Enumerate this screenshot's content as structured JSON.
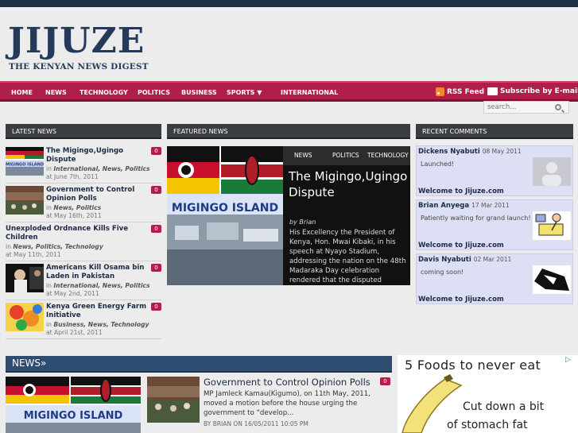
{
  "site": {
    "title": "JIJUZE",
    "tagline": "THE KENYAN NEWS DIGEST"
  },
  "nav": {
    "items": [
      "HOME",
      "NEWS",
      "TECHNOLOGY",
      "POLITICS",
      "BUSINESS",
      "SPORTS",
      "INTERNATIONAL"
    ],
    "rss": "RSS Feed",
    "subscribe": "Subscribe by E-mail"
  },
  "search": {
    "placeholder": "search..."
  },
  "latest": {
    "heading": "LATEST NEWS",
    "items": [
      {
        "title": "The Migingo,Ugingo Dispute",
        "prefix": "in",
        "categories": "International, News, Politics",
        "date": "at June 7th, 2011",
        "count": "0"
      },
      {
        "title": "Government to Control Opinion Polls",
        "prefix": "in",
        "categories": "News, Politics",
        "date": "at May 16th, 2011",
        "count": "0"
      },
      {
        "title": "Unexploded Ordnance Kills Five Children",
        "prefix": "in",
        "categories": "News, Politics, Technology",
        "date": "at May 11th, 2011",
        "count": "0"
      },
      {
        "title": "Americans Kill Osama bin Laden in Pakistan",
        "prefix": "in",
        "categories": "International, News, Politics",
        "date": "at May 2nd, 2011",
        "count": "0"
      },
      {
        "title": "Kenya Green Energy Farm Initiative",
        "prefix": "in",
        "categories": "Business, News, Technology",
        "date": "at April 21st, 2011",
        "count": "0"
      }
    ]
  },
  "featured": {
    "heading": "FEATURED NEWS",
    "tabs": [
      "NEWS",
      "POLITICS",
      "TECHNOLOGY"
    ],
    "title": "The Migingo,Ugingo Dispute",
    "by": "by Brian",
    "text": "His Excellency the President of Kenya, Hon. Mwai Kibaki, in his speech at Nyayo Stadium, addressing the nation on the 48th Madaraka Day celebration rendered that the disputed",
    "image_caption": "MIGINGO ISLAND"
  },
  "comments": {
    "heading": "RECENT COMMENTS",
    "items": [
      {
        "name": "Dickens Nyabuti",
        "date": "08 May 2011",
        "text": "Launched!",
        "post": "Welcome to Jijuze.com"
      },
      {
        "name": "Brian Anyega",
        "date": "17 Mar 2011",
        "text": "Patiently waiting for grand launch!",
        "post": "Welcome to Jijuze.com"
      },
      {
        "name": "Davis Nyabuti",
        "date": "02 Mar 2011",
        "text": "coming soon!",
        "post": "Welcome to Jijuze.com"
      }
    ]
  },
  "news_section": {
    "heading": "NEWS»",
    "big_caption": "MIGINGO ISLAND",
    "article": {
      "title": "Government to Control Opinion Polls",
      "count": "0",
      "excerpt": "MP Jamleck Kamau(Kigumo), on 11th May, 2011, moved a motion before the house urging the government to “develop...",
      "meta": "BY BRIAN ON 16/05/2011 10:05 PM"
    }
  },
  "ad": {
    "title": "5 Foods to never eat",
    "line1": "Cut down a bit",
    "line2": "of stomach fat"
  },
  "colors": {
    "nav": "#b01e4a",
    "dark": "#1f2f45",
    "comment_bg": "#dde0f4"
  }
}
